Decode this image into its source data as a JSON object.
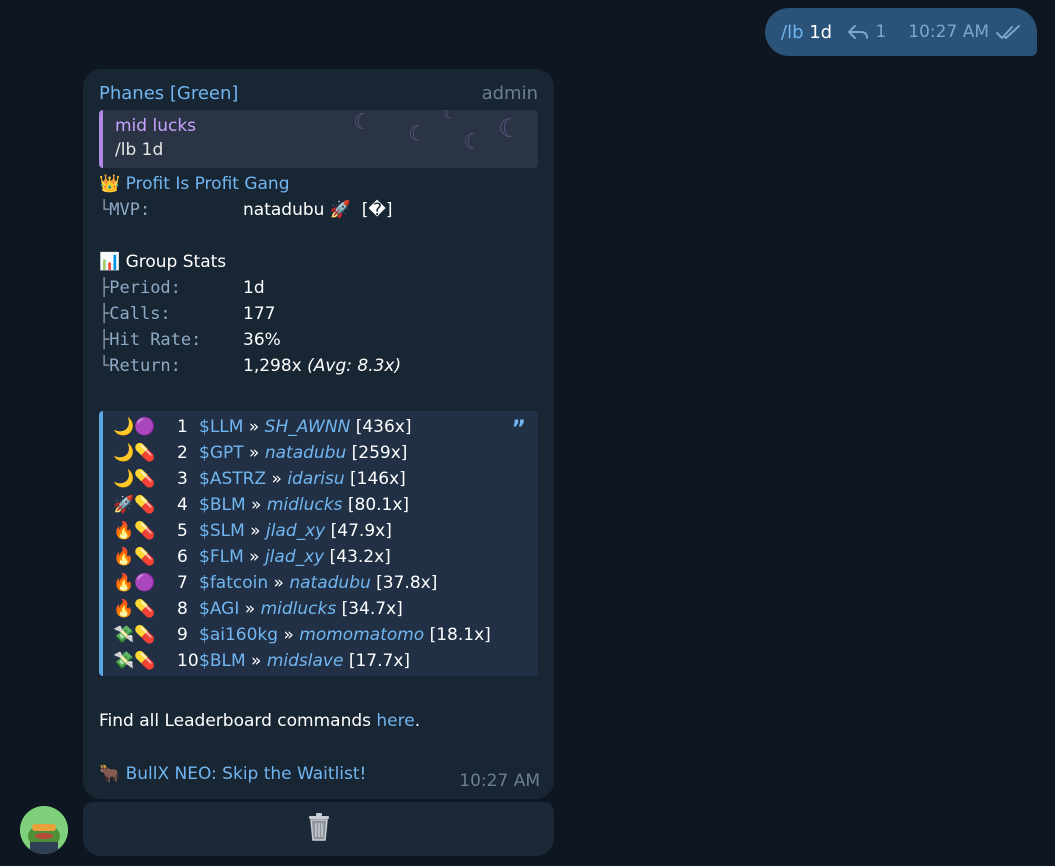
{
  "outgoing": {
    "slash": "/lb",
    "arg": "1d",
    "reply_count": "1",
    "time": "10:27 AM"
  },
  "message": {
    "sender": "Phanes [Green]",
    "role": "admin",
    "reply": {
      "name": "mid lucks",
      "text": "/lb 1d"
    },
    "gang": {
      "emoji": "👑",
      "title": "Profit Is Profit Gang"
    },
    "mvp": {
      "tree": "└",
      "label": "MVP:",
      "value": "natadubu 🚀",
      "tag": "[�]"
    },
    "stats": {
      "emoji": "📊",
      "title": "Group Stats",
      "rows": [
        {
          "tree": "├",
          "label": "Period:",
          "value": "1d"
        },
        {
          "tree": "├",
          "label": "Calls:",
          "value": "177"
        },
        {
          "tree": "├",
          "label": "Hit Rate:",
          "value": "36%"
        },
        {
          "tree": "└",
          "label": "Return:",
          "value": "1,298x",
          "note": "(Avg: 8.3x)"
        }
      ]
    },
    "leaderboard": [
      {
        "emoji": "🌙🟣",
        "rank": "1",
        "ticker": "$LLM",
        "sep": "»",
        "user": "SH_AWNN",
        "mult": "[436x]"
      },
      {
        "emoji": "🌙💊",
        "rank": "2",
        "ticker": "$GPT",
        "sep": "»",
        "user": "natadubu",
        "mult": "[259x]"
      },
      {
        "emoji": "🌙💊",
        "rank": "3",
        "ticker": "$ASTRZ",
        "sep": "»",
        "user": "idarisu",
        "mult": "[146x]"
      },
      {
        "emoji": "🚀💊",
        "rank": "4",
        "ticker": "$BLM",
        "sep": "»",
        "user": "midlucks",
        "mult": "[80.1x]"
      },
      {
        "emoji": "🔥💊",
        "rank": "5",
        "ticker": "$SLM",
        "sep": "»",
        "user": "jlad_xy",
        "mult": "[47.9x]"
      },
      {
        "emoji": "🔥💊",
        "rank": "6",
        "ticker": "$FLM",
        "sep": "»",
        "user": "jlad_xy",
        "mult": "[43.2x]"
      },
      {
        "emoji": "🔥🟣",
        "rank": "7",
        "ticker": "$fatcoin",
        "sep": "»",
        "user": "natadubu",
        "mult": "[37.8x]"
      },
      {
        "emoji": "🔥💊",
        "rank": "8",
        "ticker": "$AGI",
        "sep": "»",
        "user": "midlucks",
        "mult": "[34.7x]"
      },
      {
        "emoji": "💸💊",
        "rank": "9",
        "ticker": "$ai160kg",
        "sep": "»",
        "user": "momomatomo",
        "mult": "[18.1x]"
      },
      {
        "emoji": "💸💊",
        "rank": "10",
        "ticker": "$BLM",
        "sep": "»",
        "user": "midslave",
        "mult": "[17.7x]"
      }
    ],
    "footer_text": "Find all Leaderboard commands ",
    "footer_link": "here",
    "footer_end": ".",
    "promo": {
      "emoji": "🐂",
      "text": "BullX NEO: Skip the Waitlist!"
    },
    "time": "10:27 AM"
  },
  "colors": {
    "background": "#0e1621",
    "outgoing_bubble": "#2b5278",
    "incoming_bubble": "#182533",
    "link": "#71b6f0",
    "reply_accent": "#b088e5"
  },
  "icons": [
    "reply-arrow-icon",
    "double-check-icon",
    "quote-icon",
    "trash-icon",
    "moon-icon"
  ]
}
